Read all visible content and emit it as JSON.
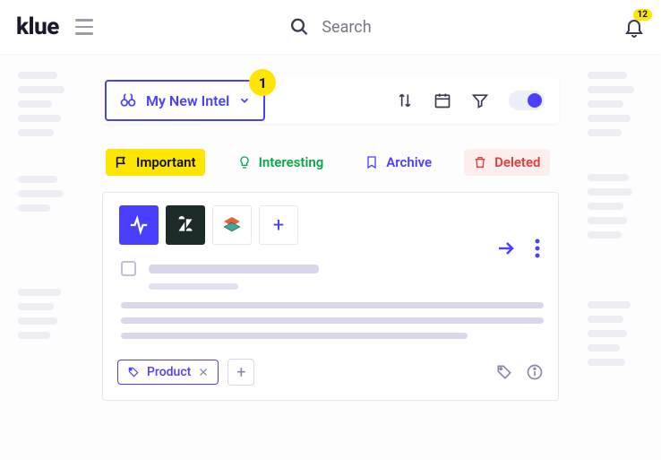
{
  "header": {
    "brand": "klue",
    "search_placeholder": "Search",
    "notifications_count": "12"
  },
  "step_badge": "1",
  "dropdown": {
    "label": "My New Intel"
  },
  "filters": {
    "important": "Important",
    "interesting": "Interesting",
    "archive": "Archive",
    "deleted": "Deleted"
  },
  "card": {
    "tags": [
      {
        "label": "Product"
      }
    ]
  }
}
